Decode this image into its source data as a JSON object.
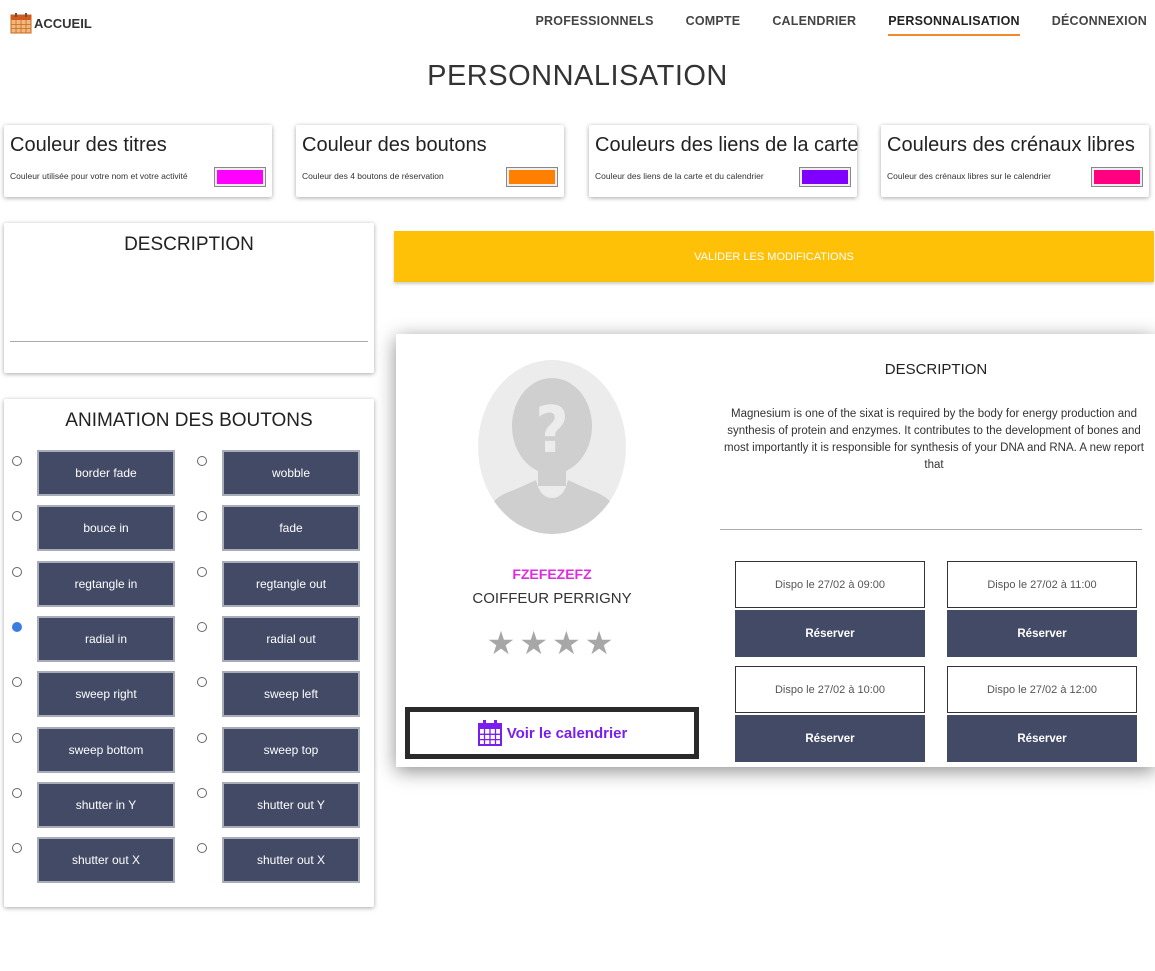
{
  "nav": {
    "home_label": "ACCUEIL",
    "links": [
      "PROFESSIONNELS",
      "COMPTE",
      "CALENDRIER",
      "PERSONNALISATION",
      "DÉCONNEXION"
    ],
    "active": "PERSONNALISATION",
    "accent_color": "#f08a2c"
  },
  "page_title": "PERSONNALISATION",
  "color_settings": [
    {
      "title": "Couleur des titres",
      "description": "Couleur utilisée pour votre nom et votre activité",
      "color": "#ff00ff"
    },
    {
      "title": "Couleur des boutons",
      "description": "Couleur des 4 boutons de réservation",
      "color": "#ff8000"
    },
    {
      "title": "Couleurs des liens de la carte",
      "description": "Couleur des liens de la carte et du calendrier",
      "color": "#8000ff"
    },
    {
      "title": "Couleurs des crénaux libres",
      "description": "Couleur des crénaux libres sur le calendrier",
      "color": "#ff0080"
    }
  ],
  "description_editor": {
    "title": "DESCRIPTION"
  },
  "animations": {
    "title": "ANIMATION DES BOUTONS",
    "options": [
      "border fade",
      "wobble",
      "bouce in",
      "fade",
      "regtangle in",
      "regtangle out",
      "radial in",
      "radial out",
      "sweep right",
      "sweep left",
      "sweep bottom",
      "sweep top",
      "shutter in Y",
      "shutter out Y",
      "shutter out X",
      "shutter out X"
    ],
    "selected": "radial in",
    "button_color": "#434a66"
  },
  "validate_label": "VALIDER LES MODIFICATIONS",
  "validate_color": "#ffc107",
  "preview": {
    "name": "FZEFEZEFZ",
    "activity": "COIFFEUR PERRIGNY",
    "stars": "★★★★",
    "calendar_link": "Voir le calendrier",
    "description_title": "DESCRIPTION",
    "description_text": "Magnesium is one of the sixat is required by the body for energy production and synthesis of protein and enzymes. It contributes to the development of bones and most importantly it is responsible for synthesis of your DNA and RNA. A new report that",
    "slots": [
      {
        "label": "Dispo le 27/02 à 09:00",
        "button": "Réserver"
      },
      {
        "label": "Dispo le 27/02 à 11:00",
        "button": "Réserver"
      },
      {
        "label": "Dispo le 27/02 à 10:00",
        "button": "Réserver"
      },
      {
        "label": "Dispo le 27/02 à 12:00",
        "button": "Réserver"
      }
    ]
  }
}
